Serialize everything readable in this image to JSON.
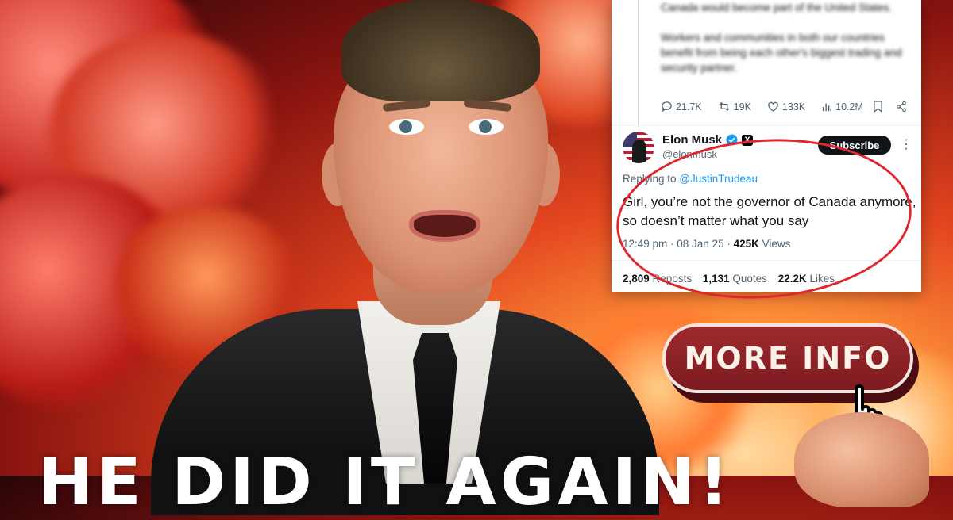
{
  "previous_tweet": {
    "line1": "Canada would become part of the United States.",
    "line2": "Workers and communities in both our countries benefit from being each other's biggest trading and security partner.",
    "replies": "21.7K",
    "reposts": "19K",
    "likes": "133K",
    "views": "10.2M"
  },
  "tweet": {
    "author_name": "Elon Musk",
    "handle": "@elonmusk",
    "subscribe_label": "Subscribe",
    "more_label": "⋮",
    "replying_prefix": "Replying to",
    "replying_handle": "@JustinTrudeau",
    "text": "Girl, you’re not the governor of Canada anymore, so doesn’t matter what you say",
    "time": "12:49 pm · 08 Jan 25 · ",
    "views_count": "425K",
    "views_label": " Views",
    "reposts_count": "2,809",
    "reposts_label": " Reposts",
    "quotes_count": "1,131",
    "quotes_label": " Quotes",
    "likes_count": "22.2K",
    "likes_label": " Likes"
  },
  "cta": {
    "label": "MORE INFO"
  },
  "headline": "HE DID IT AGAIN!",
  "colors": {
    "accent_red": "#e3262e",
    "button": "#8a2226",
    "link_blue": "#1d9bf0",
    "verified_blue": "#1d9bf0"
  }
}
